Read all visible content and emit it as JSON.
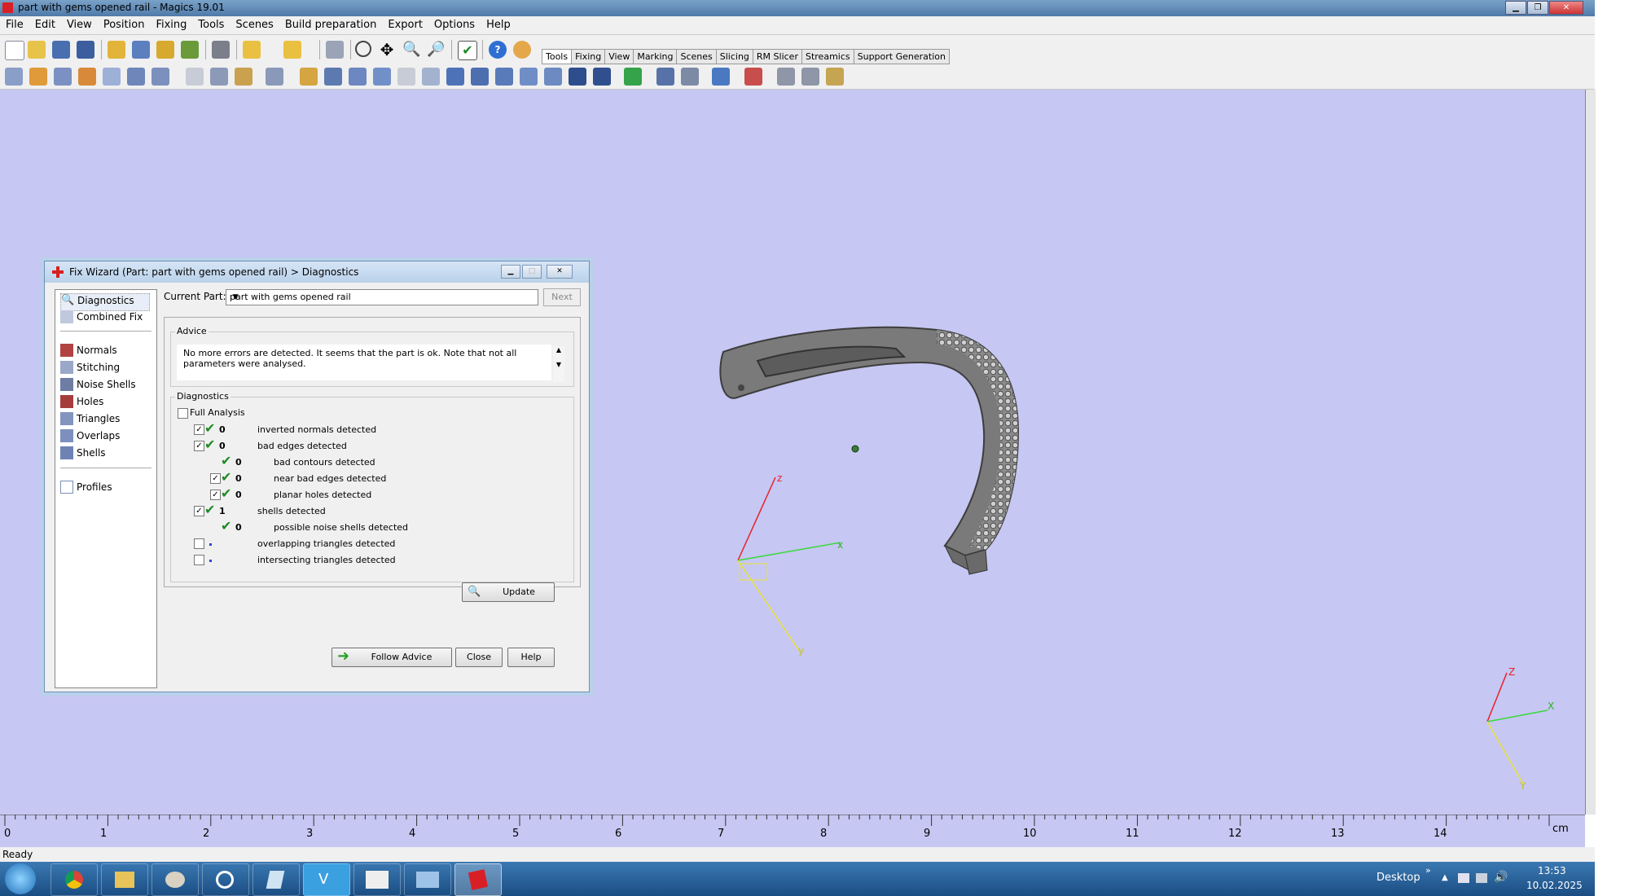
{
  "window": {
    "title": "part with gems opened rail - Magics 19.01"
  },
  "menu": [
    "File",
    "Edit",
    "View",
    "Position",
    "Fixing",
    "Tools",
    "Scenes",
    "Build preparation",
    "Export",
    "Options",
    "Help"
  ],
  "tabs": [
    "Tools",
    "Fixing",
    "View",
    "Marking",
    "Scenes",
    "Slicing",
    "RM Slicer",
    "Streamics",
    "Support Generation"
  ],
  "dialog": {
    "title": "Fix Wizard (Part: part with gems opened rail) > Diagnostics",
    "nav": [
      "Diagnostics",
      "Combined Fix",
      "Normals",
      "Stitching",
      "Noise Shells",
      "Holes",
      "Triangles",
      "Overlaps",
      "Shells",
      "Profiles"
    ],
    "current_part_label": "Current Part:",
    "current_part_value": "part with gems opened rail",
    "next_label": "Next",
    "advice_label": "Advice",
    "advice_text": "No more errors are detected. It seems that the part is ok. Note that not all parameters were analysed.",
    "diagnostics_label": "Diagnostics",
    "full_analysis_label": "Full Analysis",
    "rows": [
      {
        "num": "0",
        "text": "inverted normals detected"
      },
      {
        "num": "0",
        "text": "bad edges detected"
      },
      {
        "num": "0",
        "text": "bad contours detected"
      },
      {
        "num": "0",
        "text": "near bad edges detected"
      },
      {
        "num": "0",
        "text": "planar holes detected"
      },
      {
        "num": "1",
        "text": "shells detected"
      },
      {
        "num": "0",
        "text": "possible noise shells detected"
      },
      {
        "num": "",
        "text": "overlapping triangles detected"
      },
      {
        "num": "",
        "text": "intersecting triangles detected"
      }
    ],
    "update_label": "Update",
    "follow_advice_label": "Follow Advice",
    "close_label": "Close",
    "help_label": "Help"
  },
  "axes": {
    "x": "x",
    "y": "y",
    "z": "z",
    "X": "X",
    "Y": "Y",
    "Z": "Z"
  },
  "ruler": {
    "ticks": [
      "0",
      "1",
      "2",
      "3",
      "4",
      "5",
      "6",
      "7",
      "8",
      "9",
      "10",
      "11",
      "12",
      "13",
      "14"
    ],
    "unit": "cm"
  },
  "status": "Ready",
  "taskbar": {
    "desktop_label": "Desktop",
    "time": "13:53",
    "date": "10.02.2025"
  },
  "colors": {
    "viewport_bg": "#c6c7f2",
    "axis_x": "#3bd83b",
    "axis_y": "#e8e23a",
    "axis_z": "#e8202a"
  }
}
